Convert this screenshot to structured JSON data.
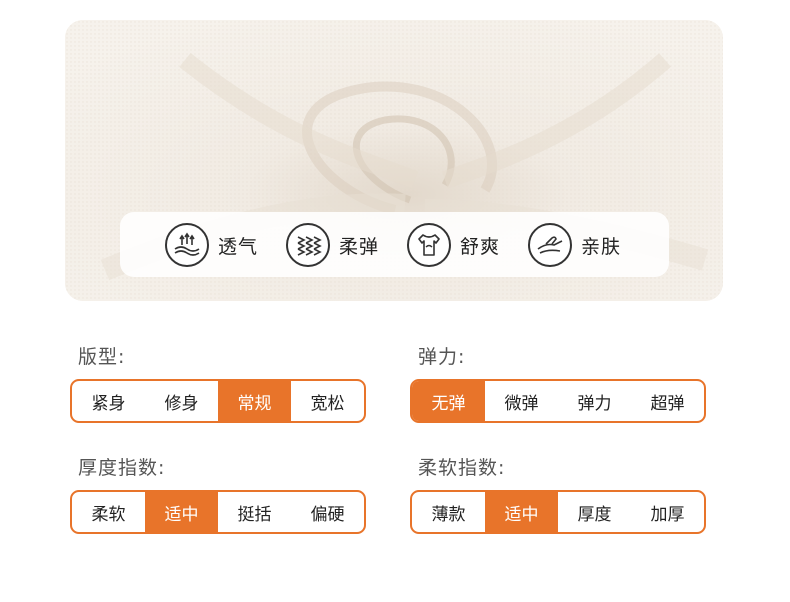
{
  "features": [
    {
      "label": "透气",
      "icon": "breathable-icon"
    },
    {
      "label": "柔弹",
      "icon": "stretch-wave-icon"
    },
    {
      "label": "舒爽",
      "icon": "tshirt-icon"
    },
    {
      "label": "亲肤",
      "icon": "skin-hand-icon"
    }
  ],
  "attributes": {
    "fit": {
      "label": "版型:",
      "options": [
        "紧身",
        "修身",
        "常规",
        "宽松"
      ],
      "selected": 2
    },
    "elasticity": {
      "label": "弹力:",
      "options": [
        "无弹",
        "微弹",
        "弹力",
        "超弹"
      ],
      "selected": 0
    },
    "thickness_index": {
      "label": "厚度指数:",
      "options": [
        "柔软",
        "适中",
        "挺括",
        "偏硬"
      ],
      "selected": 1
    },
    "softness_index": {
      "label": "柔软指数:",
      "options": [
        "薄款",
        "适中",
        "厚度",
        "加厚"
      ],
      "selected": 1
    }
  },
  "colors": {
    "accent": "#e8742a",
    "fabric": "#f4efe8"
  }
}
